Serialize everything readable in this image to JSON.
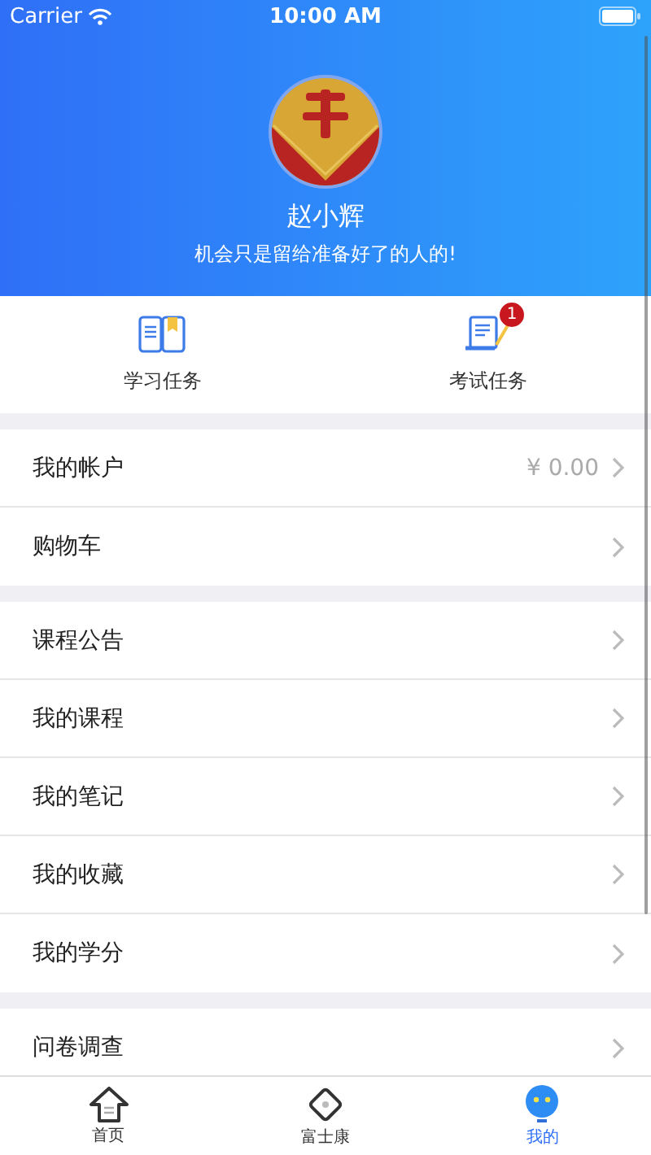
{
  "status_bar": {
    "carrier": "Carrier",
    "time": "10:00 AM"
  },
  "profile": {
    "name": "赵小辉",
    "motto": "机会只是留给准备好了的人的!"
  },
  "tasks": [
    {
      "kind": "study",
      "label": "学习任务"
    },
    {
      "kind": "exam",
      "label": "考试任务",
      "badge": "1"
    }
  ],
  "menu_groups": [
    [
      {
        "label": "我的帐户",
        "value": "¥ 0.00"
      },
      {
        "label": "购物车"
      }
    ],
    [
      {
        "label": "课程公告"
      },
      {
        "label": "我的课程"
      },
      {
        "label": "我的笔记"
      },
      {
        "label": "我的收藏"
      },
      {
        "label": "我的学分"
      }
    ],
    [
      {
        "label": "问卷调查"
      }
    ]
  ],
  "tab_bar": [
    {
      "kind": "home",
      "label": "首页",
      "selected": false
    },
    {
      "kind": "diamond",
      "label": "富士康",
      "selected": false
    },
    {
      "kind": "robot",
      "label": "我的",
      "selected": true
    }
  ]
}
